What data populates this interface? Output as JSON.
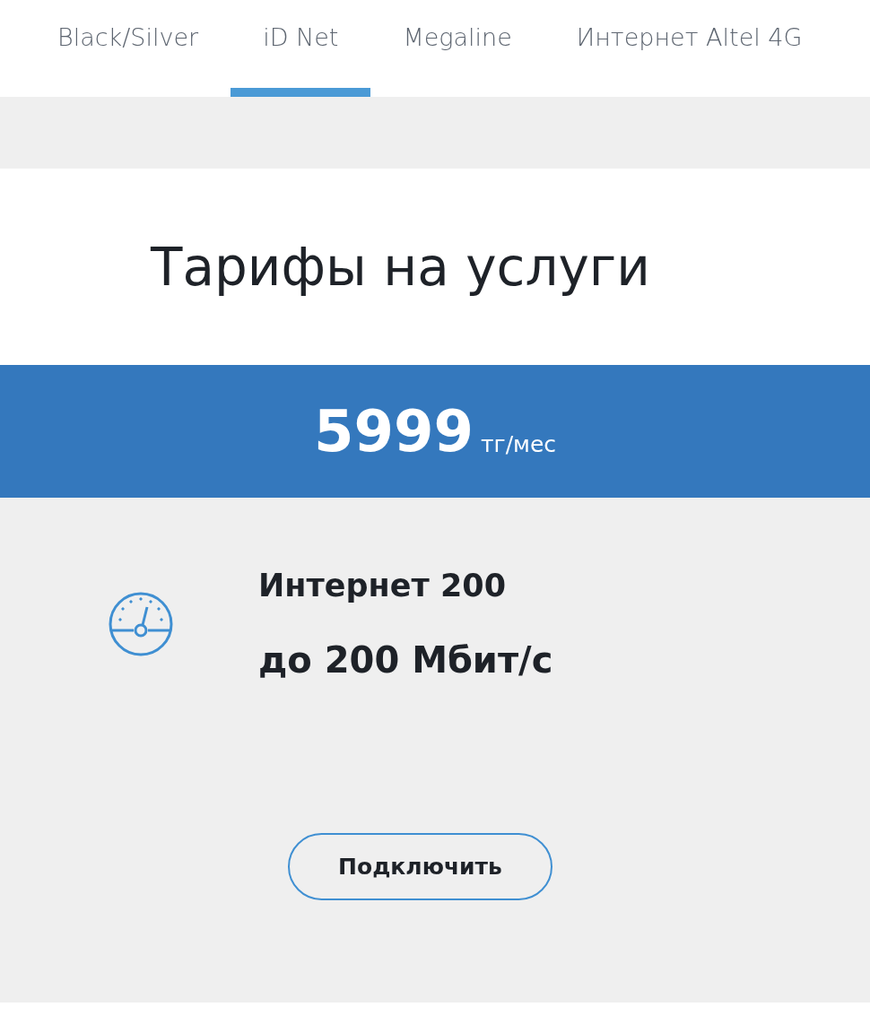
{
  "tabs": [
    {
      "label": "Black/Silver",
      "selected": false
    },
    {
      "label": "iD Net",
      "selected": true
    },
    {
      "label": "Megaline",
      "selected": false
    },
    {
      "label": "Интернет Altel 4G",
      "selected": false
    }
  ],
  "title": "Тарифы на услуги",
  "price": {
    "amount": "5999",
    "unit": "тг/мес"
  },
  "plan": {
    "name": "Интернет 200",
    "speed": "до 200 Мбит/с"
  },
  "button": "Подключить"
}
